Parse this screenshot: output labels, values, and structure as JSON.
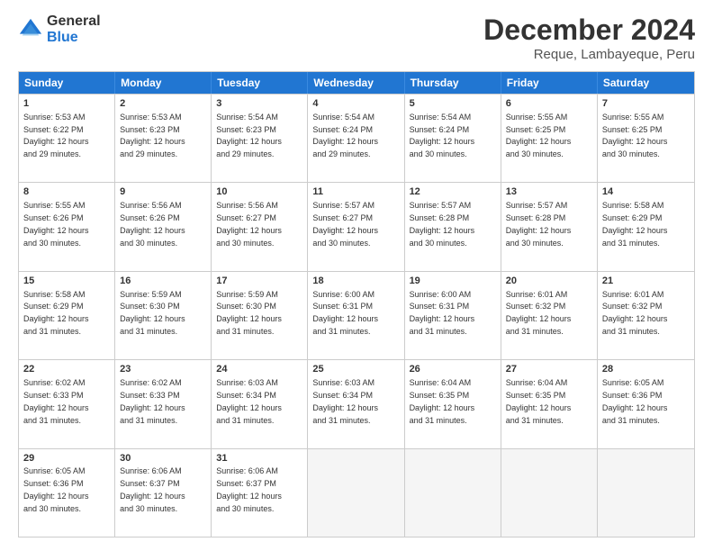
{
  "logo": {
    "general": "General",
    "blue": "Blue"
  },
  "header": {
    "title": "December 2024",
    "subtitle": "Reque, Lambayeque, Peru"
  },
  "weekdays": [
    "Sunday",
    "Monday",
    "Tuesday",
    "Wednesday",
    "Thursday",
    "Friday",
    "Saturday"
  ],
  "rows": [
    [
      {
        "day": "1",
        "info": "Sunrise: 5:53 AM\nSunset: 6:22 PM\nDaylight: 12 hours\nand 29 minutes."
      },
      {
        "day": "2",
        "info": "Sunrise: 5:53 AM\nSunset: 6:23 PM\nDaylight: 12 hours\nand 29 minutes."
      },
      {
        "day": "3",
        "info": "Sunrise: 5:54 AM\nSunset: 6:23 PM\nDaylight: 12 hours\nand 29 minutes."
      },
      {
        "day": "4",
        "info": "Sunrise: 5:54 AM\nSunset: 6:24 PM\nDaylight: 12 hours\nand 29 minutes."
      },
      {
        "day": "5",
        "info": "Sunrise: 5:54 AM\nSunset: 6:24 PM\nDaylight: 12 hours\nand 30 minutes."
      },
      {
        "day": "6",
        "info": "Sunrise: 5:55 AM\nSunset: 6:25 PM\nDaylight: 12 hours\nand 30 minutes."
      },
      {
        "day": "7",
        "info": "Sunrise: 5:55 AM\nSunset: 6:25 PM\nDaylight: 12 hours\nand 30 minutes."
      }
    ],
    [
      {
        "day": "8",
        "info": "Sunrise: 5:55 AM\nSunset: 6:26 PM\nDaylight: 12 hours\nand 30 minutes."
      },
      {
        "day": "9",
        "info": "Sunrise: 5:56 AM\nSunset: 6:26 PM\nDaylight: 12 hours\nand 30 minutes."
      },
      {
        "day": "10",
        "info": "Sunrise: 5:56 AM\nSunset: 6:27 PM\nDaylight: 12 hours\nand 30 minutes."
      },
      {
        "day": "11",
        "info": "Sunrise: 5:57 AM\nSunset: 6:27 PM\nDaylight: 12 hours\nand 30 minutes."
      },
      {
        "day": "12",
        "info": "Sunrise: 5:57 AM\nSunset: 6:28 PM\nDaylight: 12 hours\nand 30 minutes."
      },
      {
        "day": "13",
        "info": "Sunrise: 5:57 AM\nSunset: 6:28 PM\nDaylight: 12 hours\nand 30 minutes."
      },
      {
        "day": "14",
        "info": "Sunrise: 5:58 AM\nSunset: 6:29 PM\nDaylight: 12 hours\nand 31 minutes."
      }
    ],
    [
      {
        "day": "15",
        "info": "Sunrise: 5:58 AM\nSunset: 6:29 PM\nDaylight: 12 hours\nand 31 minutes."
      },
      {
        "day": "16",
        "info": "Sunrise: 5:59 AM\nSunset: 6:30 PM\nDaylight: 12 hours\nand 31 minutes."
      },
      {
        "day": "17",
        "info": "Sunrise: 5:59 AM\nSunset: 6:30 PM\nDaylight: 12 hours\nand 31 minutes."
      },
      {
        "day": "18",
        "info": "Sunrise: 6:00 AM\nSunset: 6:31 PM\nDaylight: 12 hours\nand 31 minutes."
      },
      {
        "day": "19",
        "info": "Sunrise: 6:00 AM\nSunset: 6:31 PM\nDaylight: 12 hours\nand 31 minutes."
      },
      {
        "day": "20",
        "info": "Sunrise: 6:01 AM\nSunset: 6:32 PM\nDaylight: 12 hours\nand 31 minutes."
      },
      {
        "day": "21",
        "info": "Sunrise: 6:01 AM\nSunset: 6:32 PM\nDaylight: 12 hours\nand 31 minutes."
      }
    ],
    [
      {
        "day": "22",
        "info": "Sunrise: 6:02 AM\nSunset: 6:33 PM\nDaylight: 12 hours\nand 31 minutes."
      },
      {
        "day": "23",
        "info": "Sunrise: 6:02 AM\nSunset: 6:33 PM\nDaylight: 12 hours\nand 31 minutes."
      },
      {
        "day": "24",
        "info": "Sunrise: 6:03 AM\nSunset: 6:34 PM\nDaylight: 12 hours\nand 31 minutes."
      },
      {
        "day": "25",
        "info": "Sunrise: 6:03 AM\nSunset: 6:34 PM\nDaylight: 12 hours\nand 31 minutes."
      },
      {
        "day": "26",
        "info": "Sunrise: 6:04 AM\nSunset: 6:35 PM\nDaylight: 12 hours\nand 31 minutes."
      },
      {
        "day": "27",
        "info": "Sunrise: 6:04 AM\nSunset: 6:35 PM\nDaylight: 12 hours\nand 31 minutes."
      },
      {
        "day": "28",
        "info": "Sunrise: 6:05 AM\nSunset: 6:36 PM\nDaylight: 12 hours\nand 31 minutes."
      }
    ],
    [
      {
        "day": "29",
        "info": "Sunrise: 6:05 AM\nSunset: 6:36 PM\nDaylight: 12 hours\nand 30 minutes."
      },
      {
        "day": "30",
        "info": "Sunrise: 6:06 AM\nSunset: 6:37 PM\nDaylight: 12 hours\nand 30 minutes."
      },
      {
        "day": "31",
        "info": "Sunrise: 6:06 AM\nSunset: 6:37 PM\nDaylight: 12 hours\nand 30 minutes."
      },
      {
        "day": "",
        "info": ""
      },
      {
        "day": "",
        "info": ""
      },
      {
        "day": "",
        "info": ""
      },
      {
        "day": "",
        "info": ""
      }
    ]
  ]
}
